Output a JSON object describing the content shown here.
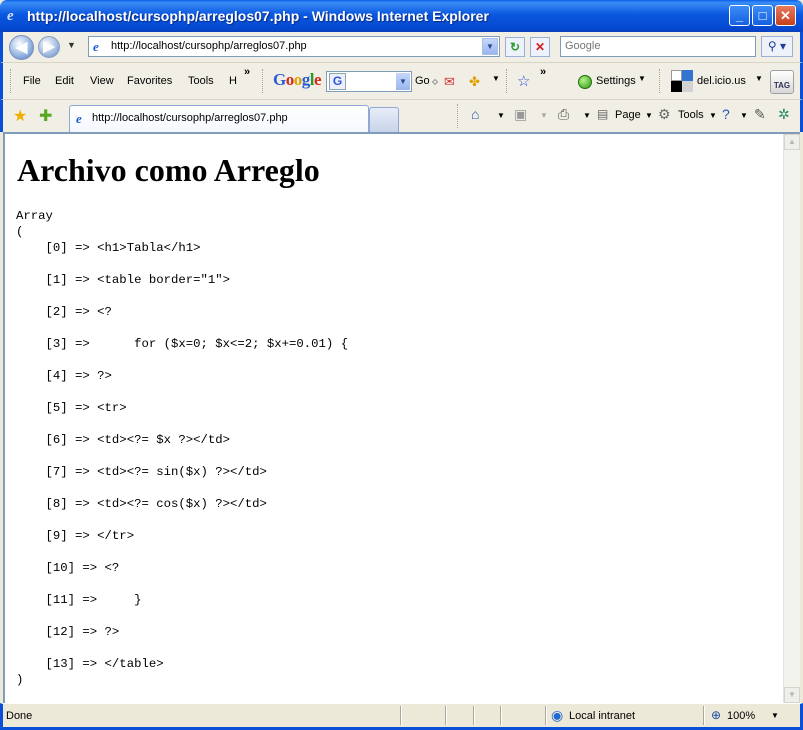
{
  "window": {
    "title": "http://localhost/cursophp/arreglos07.php - Windows Internet Explorer",
    "min_glyph": "_",
    "max_glyph": "□",
    "close_glyph": "✕"
  },
  "address_bar": {
    "url": "http://localhost/cursophp/arreglos07.php",
    "search_placeholder": "Google"
  },
  "menu": {
    "items": [
      "File",
      "Edit",
      "View",
      "Favorites",
      "Tools",
      "H"
    ],
    "overflow": "»"
  },
  "google_toolbar": {
    "logo_parts": [
      "G",
      "o",
      "o",
      "g",
      "l",
      "e"
    ],
    "go_label": "Go",
    "overflow": "»",
    "settings_label": "Settings",
    "delicious_label": "del.icio.us",
    "tag_label": "TAG"
  },
  "tab": {
    "label": "http://localhost/cursophp/arreglos07.php"
  },
  "command_bar": {
    "page_label": "Page",
    "tools_label": "Tools"
  },
  "content": {
    "heading": "Archivo como Arreglo",
    "array_dump": "Array\n(\n    [0] => <h1>Tabla</h1>\n\n    [1] => <table border=\"1\">\n\n    [2] => <?\n\n    [3] =>      for ($x=0; $x<=2; $x+=0.01) {\n\n    [4] => ?>\n\n    [5] => <tr>\n\n    [6] => <td><?= $x ?></td>\n\n    [7] => <td><?= sin($x) ?></td>\n\n    [8] => <td><?= cos($x) ?></td>\n\n    [9] => </tr>\n\n    [10] => <?\n\n    [11] =>     }\n\n    [12] => ?>\n\n    [13] => </table>\n)"
  },
  "status": {
    "text": "Done",
    "zone": "Local intranet",
    "zoom": "100%"
  },
  "icons": {
    "back": "back-arrow-icon",
    "forward": "forward-arrow-icon",
    "refresh": "refresh-icon",
    "stop": "stop-icon",
    "search": "search-icon",
    "home": "home-icon",
    "feeds": "feeds-icon",
    "print": "print-icon",
    "help": "help-icon"
  }
}
